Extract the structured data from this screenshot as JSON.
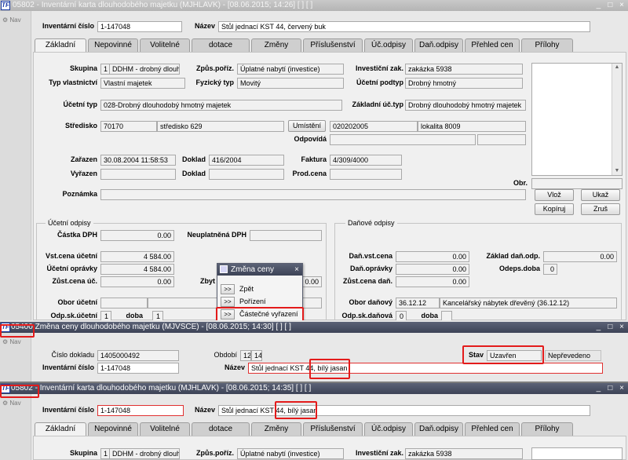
{
  "nav_label": "Nav",
  "win1": {
    "icon": "TF",
    "title": "05802 - Inventární karta dlouhodobého majetku (MJHLAVK) - [08.06.2015; 14:26]  [ ]  [ ]",
    "inv_label": "Inventární číslo",
    "inv_value": "1-147048",
    "nazev_label": "Název",
    "nazev_value": "Stůl jednací KST 44, červený buk",
    "tabs": [
      "Základní",
      "Nepovinné",
      "Volitelné",
      "dotace",
      "Změny",
      "Příslušenství",
      "Úč.odpisy",
      "Daň.odpisy",
      "Přehled cen",
      "Přílohy"
    ],
    "skupina_label": "Skupina",
    "skupina_code": "1",
    "skupina_value": "DDHM - drobný dlouho",
    "zpusob_label": "Způs.poříz.",
    "zpusob_value": "Úplatné nabytí (investice)",
    "invzak_label": "Investiční zak.",
    "invzak_value": "zakázka 5938",
    "typvl_label": "Typ vlastnictví",
    "typvl_value": "Vlastní majetek",
    "fyz_label": "Fyzický typ",
    "fyz_value": "Movitý",
    "ucpod_label": "Účetní podtyp",
    "ucpod_value": "Drobný hmotný",
    "uctyp_label": "Účetní typ",
    "uctyp_value": "028-Drobný dlouhodobý hmotný majetek",
    "zaklad_label": "Základní úč.typ",
    "zaklad_value": "Drobný dlouhodobý hmotný majetek",
    "stred_label": "Středisko",
    "stred_code": "70170",
    "stred_value": "středisko 629",
    "umist_label": "Umístění",
    "umist_code": "020202005",
    "umist_value": "lokalita 8009",
    "odpov_label": "Odpovídá",
    "zar_label": "Zařazen",
    "zar_value": "30.08.2004 11:58:53",
    "doklad_label": "Doklad",
    "doklad_value": "416/2004",
    "faktura_label": "Faktura",
    "faktura_value": "4/309/4000",
    "vyr_label": "Vyřazen",
    "doklad2_label": "Doklad",
    "prodcena_label": "Prod.cena",
    "obr_label": "Obr.",
    "pozn_label": "Poznámka",
    "btn_vloz": "Vlož",
    "btn_ukaz": "Ukaž",
    "btn_kopiruj": "Kopíruj",
    "btn_zrus": "Zruš",
    "ucetni_group": "Účetní odpisy",
    "danove_group": "Daňové odpisy",
    "dph_label": "Částka DPH",
    "dph_value": "0.00",
    "neupl_label": "Neuplatněná DPH",
    "vst_label": "Vst.cena účetní",
    "vst_value": "4 584.00",
    "ucopr_label": "Účetní oprávky",
    "ucopr_value": "4 584.00",
    "zust_label": "Zůst.cena úč.",
    "zust_value": "0.00",
    "zbyt_label": "Zbyt",
    "zbyt_value": "0.00",
    "obor_label": "Obor účetní",
    "odpsk_label": "Odp.sk.účetní",
    "odpsk_value": "1",
    "doba_label": "doba",
    "doba_value": "1",
    "danvst_label": "Daň.vst.cena",
    "danvst_value": "0.00",
    "danopr_label": "Daň.oprávky",
    "danopr_value": "0.00",
    "zustdan_label": "Zůst.cena daň.",
    "zustdan_value": "0.00",
    "zakldan_label": "Základ daň.odp.",
    "zakldan_value": "0.00",
    "odeps_label": "Odeps.doba",
    "odeps_value": "0",
    "obordan_label": "Obor daňový",
    "obordan_code": "36.12.12",
    "obordan_value": "Kancelářský nábytek dřevěný (36.12.12)",
    "odpskdan_label": "Odp.sk.daňová",
    "odpskdan_value": "0",
    "dobadan_label": "doba"
  },
  "popup": {
    "title": "Změna ceny",
    "items": [
      {
        "btn": ">>",
        "label": "Zpět"
      },
      {
        "btn": ">>",
        "label": "Pořízení"
      },
      {
        "btn": ">>",
        "label": "Částečné vyřazení"
      }
    ]
  },
  "win2": {
    "code": "05400",
    "title": "Změna ceny dlouhodobého majetku (MJVSCE) - [08.06.2015; 14:30]  [ ]  [ ]",
    "cislo_label": "Číslo dokladu",
    "cislo_value": "1405000492",
    "obdobi_label": "Období",
    "obdobi_a": "12",
    "obdobi_b": "14",
    "stav_label": "Stav",
    "stav_value": "Uzavřen",
    "stav_extra": "Nepřevedeno",
    "inv_label": "Inventární číslo",
    "inv_value": "1-147048",
    "nazev_label": "Název",
    "nazev_value": "Stůl jednací KST 44,",
    "nazev_hl": "bílý jasan"
  },
  "win3": {
    "code": "05802",
    "title": " - Inventární karta dlouhodobého majetku (MJHLAVK) - [08.06.2015; 14:35]  [ ]  [ ]",
    "inv_label": "Inventární číslo",
    "inv_value": "1-147048",
    "nazev_label": "Název",
    "nazev_value": "Stůl jednací KST 44,",
    "nazev_hl": "bílý jasan",
    "skupina_label": "Skupina",
    "skupina_code": "1",
    "skupina_value": "DDHM - drobný dlouho",
    "zpusob_label": "Způs.poříz.",
    "zpusob_value": "Úplatné nabytí (investice)",
    "invzak_label": "Investiční zak.",
    "invzak_value": "zakázka 5938"
  },
  "window_buttons": {
    "min": "_",
    "max": "□",
    "close": "×"
  }
}
